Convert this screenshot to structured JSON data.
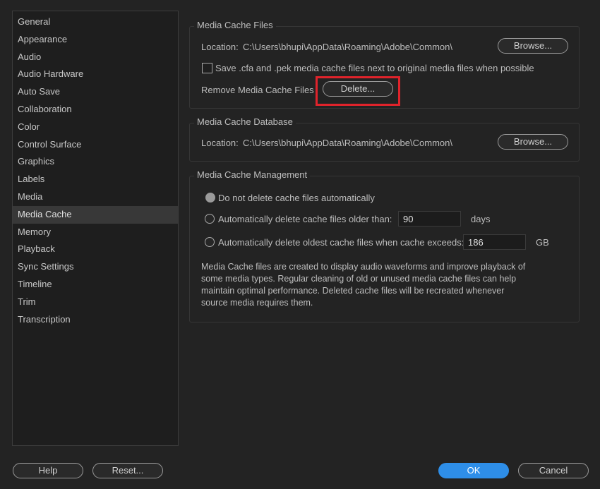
{
  "sidebar": {
    "items": [
      {
        "label": "General"
      },
      {
        "label": "Appearance"
      },
      {
        "label": "Audio"
      },
      {
        "label": "Audio Hardware"
      },
      {
        "label": "Auto Save"
      },
      {
        "label": "Collaboration"
      },
      {
        "label": "Color"
      },
      {
        "label": "Control Surface"
      },
      {
        "label": "Graphics"
      },
      {
        "label": "Labels"
      },
      {
        "label": "Media"
      },
      {
        "label": "Media Cache"
      },
      {
        "label": "Memory"
      },
      {
        "label": "Playback"
      },
      {
        "label": "Sync Settings"
      },
      {
        "label": "Timeline"
      },
      {
        "label": "Trim"
      },
      {
        "label": "Transcription"
      }
    ],
    "selected": "Media Cache"
  },
  "media_cache_files": {
    "title": "Media Cache Files",
    "location_label": "Location:",
    "location_path": "C:\\Users\\bhupi\\AppData\\Roaming\\Adobe\\Common\\",
    "browse_label": "Browse...",
    "save_next_label": "Save .cfa and .pek media cache files next to original media files when possible",
    "save_next_checked": false,
    "remove_label": "Remove Media Cache Files",
    "delete_label": "Delete..."
  },
  "media_cache_database": {
    "title": "Media Cache Database",
    "location_label": "Location:",
    "location_path": "C:\\Users\\bhupi\\AppData\\Roaming\\Adobe\\Common\\",
    "browse_label": "Browse..."
  },
  "media_cache_management": {
    "title": "Media Cache Management",
    "option_no_delete": "Do not delete cache files automatically",
    "option_older_than": "Automatically delete cache files older than:",
    "older_than_value": "90",
    "older_than_unit": "days",
    "option_exceeds": "Automatically delete oldest cache files when cache exceeds:",
    "exceeds_value": "186",
    "exceeds_unit": "GB",
    "selected_option": "no_delete",
    "description": "Media Cache files are created to display audio waveforms and improve playback of some media types.  Regular cleaning of old or unused media cache files can help maintain optimal performance. Deleted cache files will be recreated whenever source media requires them."
  },
  "footer": {
    "help_label": "Help",
    "reset_label": "Reset...",
    "ok_label": "OK",
    "cancel_label": "Cancel"
  },
  "colors": {
    "background": "#232323",
    "accent": "#2e8ee8",
    "highlight": "#e0232b"
  }
}
